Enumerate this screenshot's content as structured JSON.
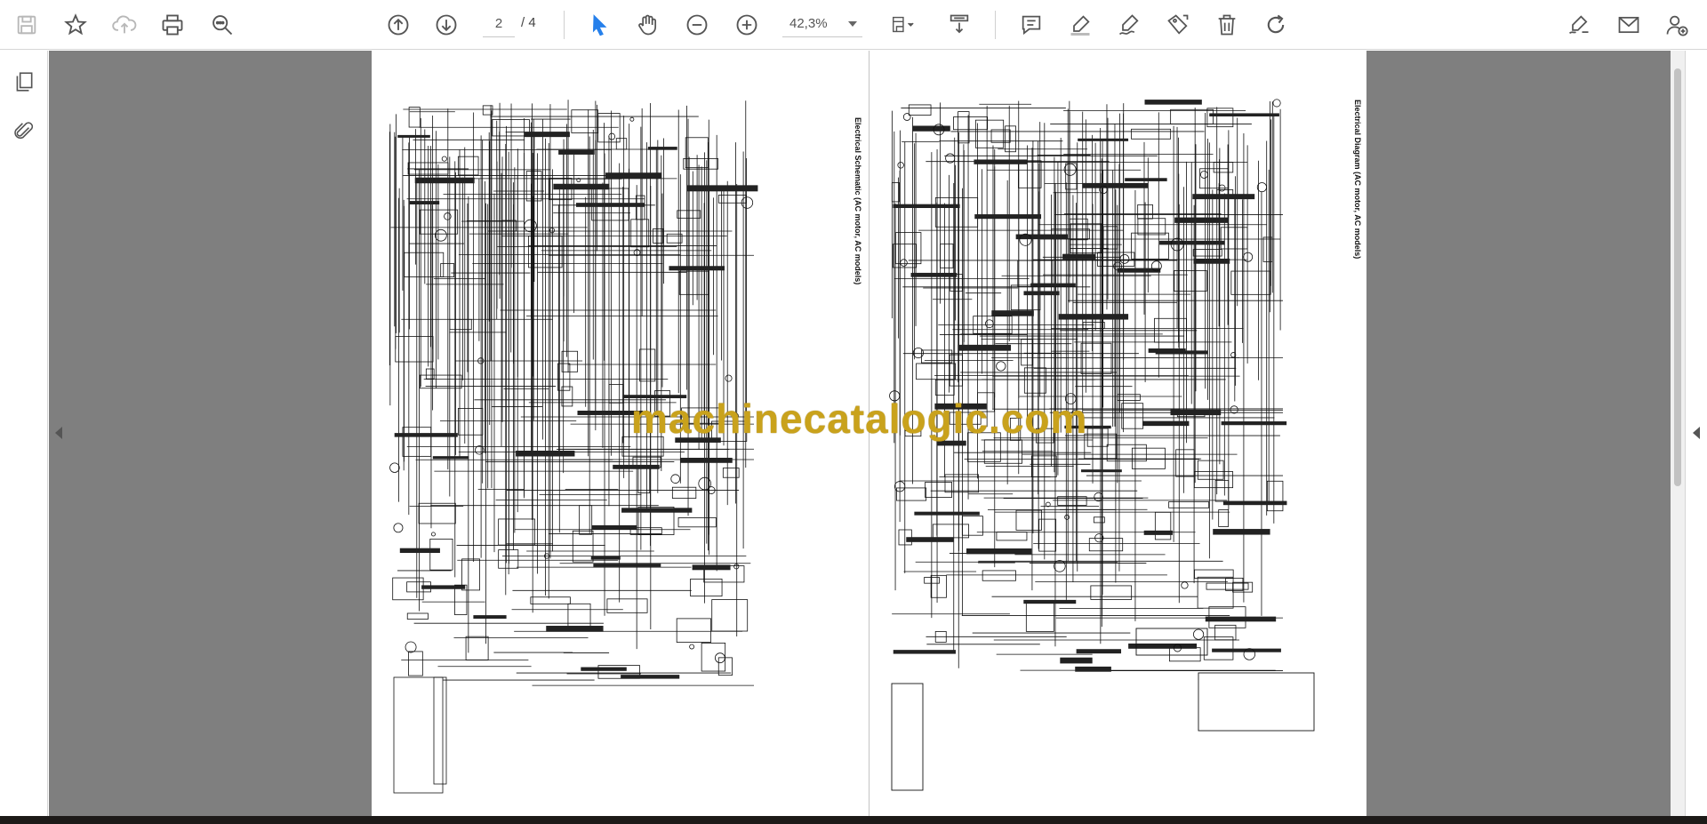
{
  "toolbar": {
    "page_current": "2",
    "page_total": "/ 4",
    "zoom_value": "42,3%"
  },
  "document": {
    "left_page_title": "Electrical Schematic (AC motor, AC models)",
    "right_page_title": "Electrical Diagram (AC motor, AC models)",
    "watermark": "machinecatalogic.com"
  },
  "colors": {
    "active_tool": "#2680eb",
    "watermark": "#c9a21c",
    "viewer_bg": "#7f7f7f"
  }
}
